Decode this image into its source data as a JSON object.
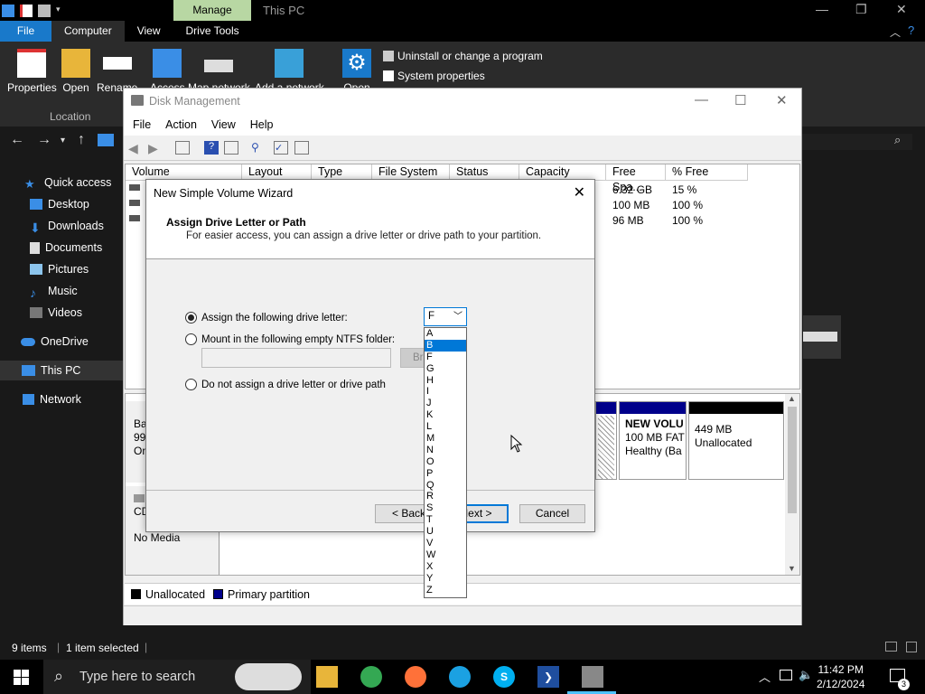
{
  "explorer": {
    "context_tab": "Manage",
    "window_title": "This PC",
    "tabs": {
      "file": "File",
      "computer": "Computer",
      "view": "View",
      "drive_tools": "Drive Tools"
    },
    "ribbon": {
      "properties": "Properties",
      "open": "Open",
      "rename": "Rename",
      "access": "Access",
      "map_network": "Map network",
      "add_network": "Add a network",
      "open2": "Open",
      "uninstall": "Uninstall or change a program",
      "system_properties": "System properties",
      "group_location": "Location"
    },
    "sidebar": {
      "quick_access": "Quick access",
      "desktop": "Desktop",
      "downloads": "Downloads",
      "documents": "Documents",
      "pictures": "Pictures",
      "music": "Music",
      "videos": "Videos",
      "onedrive": "OneDrive",
      "this_pc": "This PC",
      "network": "Network"
    },
    "status": {
      "items": "9 items",
      "selected": "1 item selected"
    }
  },
  "disk_mgmt": {
    "title": "Disk Management",
    "menu": {
      "file": "File",
      "action": "Action",
      "view": "View",
      "help": "Help"
    },
    "columns": {
      "volume": "Volume",
      "layout": "Layout",
      "type": "Type",
      "file_system": "File System",
      "status": "Status",
      "capacity": "Capacity",
      "free_space": "Free Spa...",
      "percent_free": "% Free"
    },
    "rows": [
      {
        "free": "6.32 GB",
        "pct": "15 %"
      },
      {
        "free": "100 MB",
        "pct": "100 %"
      },
      {
        "free": "96 MB",
        "pct": "100 %"
      }
    ],
    "disk0": {
      "line1": "Ba",
      "line2": "99.",
      "line3": "On"
    },
    "part_new": {
      "name": "NEW VOLU",
      "size": "100 MB FAT",
      "status": "Healthy (Ba"
    },
    "part_unalloc": {
      "size": "449 MB",
      "status": "Unallocated"
    },
    "cd": {
      "label": "CD",
      "media": "No Media"
    },
    "legend": {
      "unallocated": "Unallocated",
      "primary": "Primary partition"
    },
    "colors": {
      "unallocated": "#000000",
      "primary": "#00008b"
    }
  },
  "wizard": {
    "title": "New Simple Volume Wizard",
    "heading": "Assign Drive Letter or Path",
    "subheading": "For easier access, you can assign a drive letter or drive path to your partition.",
    "option_letter": "Assign the following drive letter:",
    "option_folder": "Mount in the following empty NTFS folder:",
    "option_none": "Do not assign a drive letter or drive path",
    "browse": "Bro",
    "selected_letter": "F",
    "back": "< Back",
    "next": "Next >",
    "cancel": "Cancel",
    "letters": [
      "A",
      "B",
      "F",
      "G",
      "H",
      "I",
      "J",
      "K",
      "L",
      "M",
      "N",
      "O",
      "P",
      "Q",
      "R",
      "S",
      "T",
      "U",
      "V",
      "W",
      "X",
      "Y",
      "Z"
    ],
    "highlighted": "B"
  },
  "taskbar": {
    "search_placeholder": "Type here to search",
    "time": "11:42 PM",
    "date": "2/12/2024",
    "notification_count": "3"
  }
}
